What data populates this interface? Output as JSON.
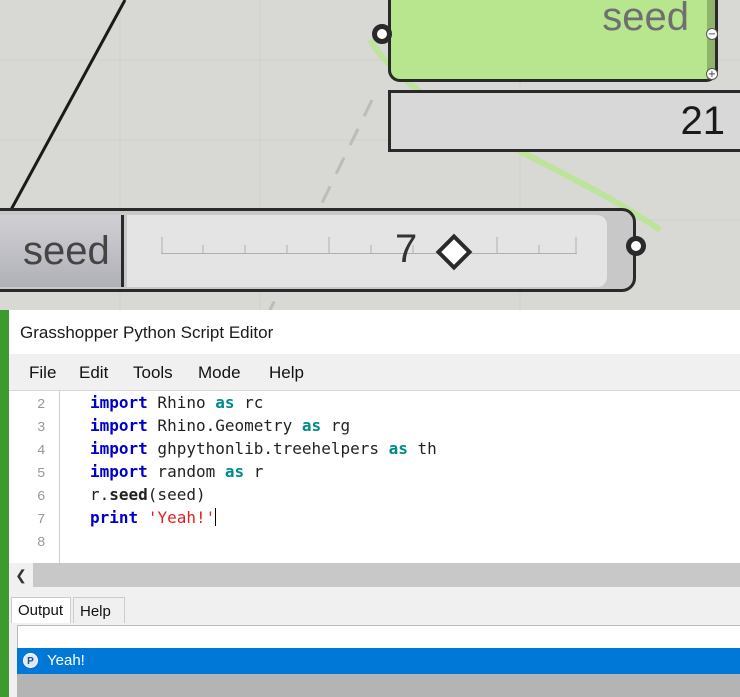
{
  "canvas": {
    "seed_node_label": "seed",
    "panel_value": "21",
    "slider": {
      "name": "seed",
      "value": "7"
    }
  },
  "editor": {
    "title": "Grasshopper Python Script Editor",
    "menu": [
      "File",
      "Edit",
      "Tools",
      "Mode",
      "Help"
    ],
    "line_numbers": [
      "2",
      "3",
      "4",
      "5",
      "6",
      "7",
      "8"
    ],
    "code": {
      "l2": {
        "kw": "import",
        "a": " Rhino ",
        "kw2": "as",
        "b": " rc"
      },
      "l3": {
        "kw": "import",
        "a": " Rhino.Geometry ",
        "kw2": "as",
        "b": " rg"
      },
      "l4": {
        "kw": "import",
        "a": " ghpythonlib.treehelpers ",
        "kw2": "as",
        "b": " th"
      },
      "l5": {
        "kw": "import",
        "a": " random ",
        "kw2": "as",
        "b": " r"
      },
      "l6": {
        "a": "r.",
        "fn": "seed",
        "b": "(seed)"
      },
      "l7": {
        "kw": "print",
        "str": "'Yeah!'"
      }
    },
    "tabs": [
      "Output",
      "Help"
    ],
    "output_lines": [
      "Yeah!"
    ]
  },
  "colors": {
    "node_green": "#b8e68f",
    "selection_blue": "#0078d7",
    "keyword": "#0000cc",
    "keyword_as": "#008b8b",
    "string": "#e02020"
  }
}
